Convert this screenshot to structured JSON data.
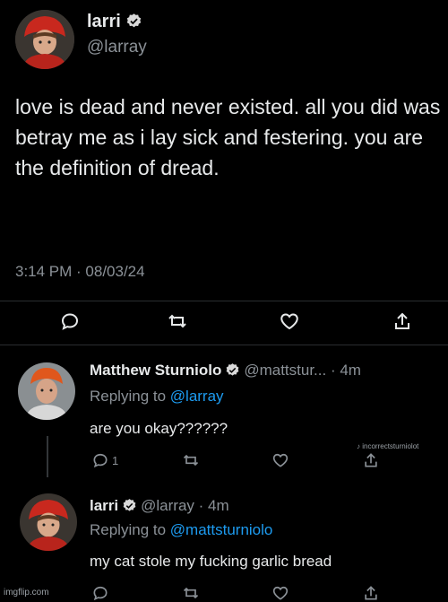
{
  "main_tweet": {
    "display_name": "larri",
    "handle": "@larray",
    "text": "love is dead and never existed. all you did was betray me as i lay sick and festering. you are the definition of dread.",
    "meta": "3:14 PM · 08/03/24",
    "actions": {
      "reply_icon": "reply-bubble-icon",
      "retweet_icon": "retweet-icon",
      "like_icon": "heart-icon",
      "share_icon": "share-icon"
    }
  },
  "reply_1": {
    "display_name": "Matthew Sturniolo",
    "handle_time": "@mattstur... · 4m",
    "replying_prefix": "Replying to ",
    "replying_to": "@larray",
    "text": "are you okay??????",
    "reply_count": "1"
  },
  "reply_2": {
    "display_name": "larri",
    "handle_time": "@larray · 4m",
    "replying_prefix": "Replying to ",
    "replying_to": "@mattsturniolo",
    "text": "my cat stole my fucking garlic bread"
  },
  "watermarks": {
    "corner": "incorrectsturniolot",
    "bottom": "imgflip.com"
  },
  "colors": {
    "background": "#000000",
    "text_primary": "#e7e9ea",
    "text_secondary": "#8b9197",
    "link": "#1d9bf0",
    "verified_badge": "#d9d9d9"
  }
}
